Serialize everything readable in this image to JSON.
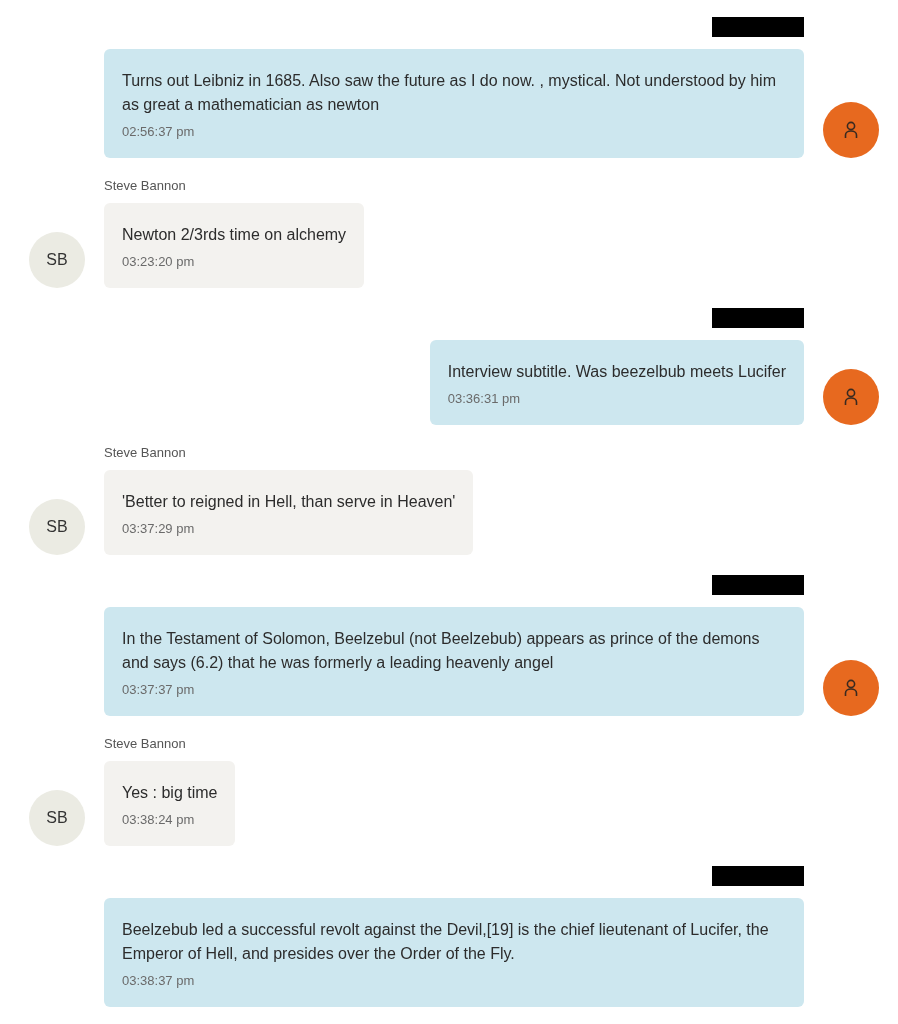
{
  "messages": [
    {
      "kind": "outgoing",
      "sender_redacted": true,
      "avatar": true,
      "text": "Turns out Leibniz in 1685. Also saw the future as I do now.  , mystical.  Not understood by him  as great a mathematician as newton",
      "time": "02:56:37 pm"
    },
    {
      "kind": "incoming",
      "sender": "Steve Bannon",
      "avatar": true,
      "initials": "SB",
      "text": "Newton 2/3rds time on alchemy",
      "time": "03:23:20 pm"
    },
    {
      "kind": "outgoing",
      "sender_redacted": true,
      "avatar": true,
      "text": "Interview subtitle. Was beezelbub meets Lucifer",
      "time": "03:36:31 pm"
    },
    {
      "kind": "incoming",
      "sender": "Steve Bannon",
      "avatar": true,
      "initials": "SB",
      "text": "'Better to reigned in Hell, than serve in Heaven'",
      "time": "03:37:29 pm"
    },
    {
      "kind": "outgoing",
      "sender_redacted": true,
      "avatar": true,
      "text": "In the Testament of Solomon, Beelzebul (not Beelzebub) appears as prince of the demons and says (6.2) that he was formerly a leading heavenly angel",
      "time": "03:37:37 pm"
    },
    {
      "kind": "incoming",
      "sender": "Steve Bannon",
      "avatar": true,
      "initials": "SB",
      "text": "Yes : big time",
      "time": "03:38:24 pm"
    },
    {
      "kind": "outgoing",
      "sender_redacted": true,
      "avatar": false,
      "text": "Beelzebub led a successful revolt against the Devil,[19] is the chief lieutenant of Lucifer, the Emperor of Hell, and presides over the Order of the Fly.",
      "time": "03:38:37 pm"
    }
  ]
}
